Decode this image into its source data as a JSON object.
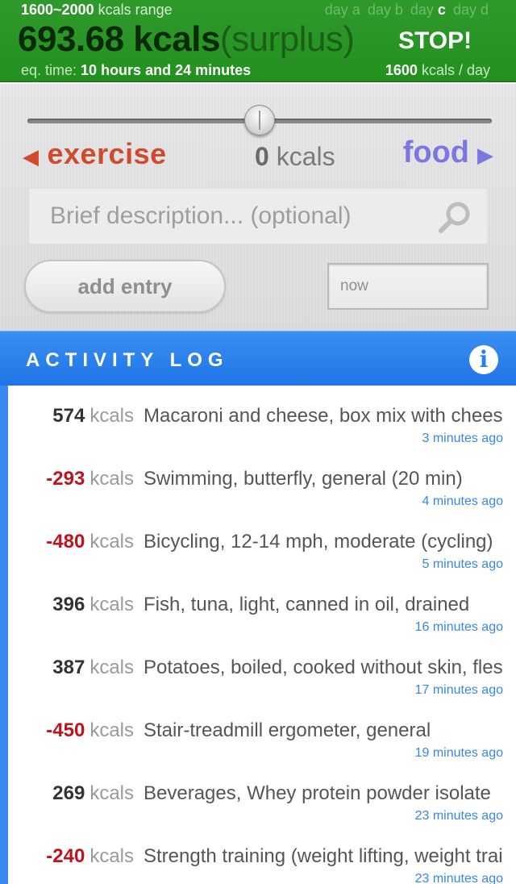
{
  "header": {
    "range_value": "1600~2000",
    "range_suffix": "kcals range",
    "days": [
      {
        "prefix": "day",
        "letter": "a",
        "active": false
      },
      {
        "prefix": "day",
        "letter": "b",
        "active": false
      },
      {
        "prefix": "day",
        "letter": "c",
        "active": true
      },
      {
        "prefix": "day",
        "letter": "d",
        "active": false
      }
    ],
    "balance_value": "693.68 kcals",
    "balance_state": "(surplus)",
    "stop_label": "STOP!",
    "eq_label": "eq. time:",
    "eq_value": "10 hours and 24 minutes",
    "per_day_value": "1600",
    "per_day_suffix": "kcals / day"
  },
  "controls": {
    "exercise_label": "exercise",
    "food_label": "food",
    "slider_value": "0",
    "slider_unit": "kcals",
    "slider_position": 0.5,
    "search_placeholder": "Brief description... (optional)",
    "add_entry_label": "add entry",
    "time_value": "now"
  },
  "log": {
    "title": "ACTIVITY LOG",
    "unit": "kcals",
    "entries": [
      {
        "kcal": "574",
        "negative": false,
        "desc": "Macaroni and cheese, box mix with cheese sauce",
        "time": "3 minutes ago"
      },
      {
        "kcal": "-293",
        "negative": true,
        "desc": "Swimming, butterfly, general (20 min)",
        "time": "4 minutes ago"
      },
      {
        "kcal": "-480",
        "negative": true,
        "desc": "Bicycling, 12-14 mph, moderate (cycling)",
        "time": "5 minutes ago"
      },
      {
        "kcal": "396",
        "negative": false,
        "desc": "Fish, tuna, light, canned in oil, drained",
        "time": "16 minutes ago"
      },
      {
        "kcal": "387",
        "negative": false,
        "desc": "Potatoes, boiled, cooked without skin, flesh",
        "time": "17 minutes ago"
      },
      {
        "kcal": "-450",
        "negative": true,
        "desc": "Stair-treadmill ergometer, general",
        "time": "19 minutes ago"
      },
      {
        "kcal": "269",
        "negative": false,
        "desc": "Beverages, Whey protein powder isolate",
        "time": "23 minutes ago"
      },
      {
        "kcal": "-240",
        "negative": true,
        "desc": "Strength training (weight lifting, weight training)",
        "time": "23 minutes ago"
      }
    ]
  },
  "colors": {
    "header_green": "#2f9a2b",
    "exercise_red": "#d04a2e",
    "food_purple": "#7b77e0",
    "log_blue": "#1f74e6",
    "negative_red": "#c1121c"
  }
}
